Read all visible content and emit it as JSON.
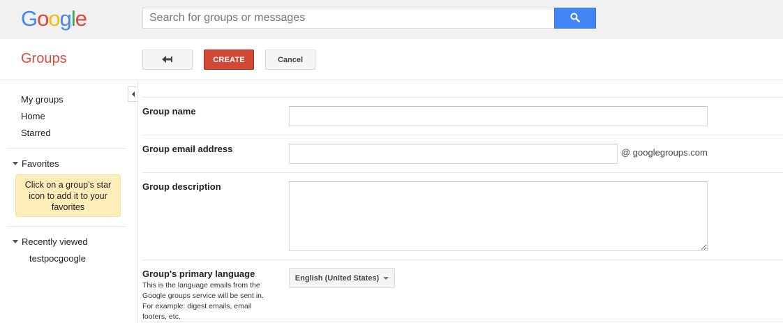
{
  "logo": {
    "letters": [
      "G",
      "o",
      "o",
      "g",
      "l",
      "e"
    ],
    "colors": [
      "#4285f4",
      "#ea4335",
      "#fbbc05",
      "#4285f4",
      "#34a853",
      "#ea4335"
    ]
  },
  "search": {
    "placeholder": "Search for groups or messages",
    "button_icon": "search-icon"
  },
  "app": {
    "title": "Groups",
    "title_color": "#dd4b39"
  },
  "toolbar": {
    "back_icon": "back-arrow-icon",
    "create_label": "CREATE",
    "cancel_label": "Cancel",
    "create_color": "#d14836"
  },
  "sidebar": {
    "nav": [
      "My groups",
      "Home",
      "Starred"
    ],
    "favorites_label": "Favorites",
    "favorites_note": "Click on a group’s star icon to add it to your favorites",
    "recent_label": "Recently viewed",
    "recent_items": [
      "testpocgoogle"
    ]
  },
  "form": {
    "group_name_label": "Group name",
    "group_name_value": "",
    "email_label": "Group email address",
    "email_value": "",
    "email_suffix": "@ googlegroups.com",
    "description_label": "Group description",
    "description_value": "",
    "language_label": "Group's primary language",
    "language_help": "This is the language emails from the Google groups service will be sent in. For example: digest emails, email footers, etc.",
    "language_value": "English (United States)"
  }
}
